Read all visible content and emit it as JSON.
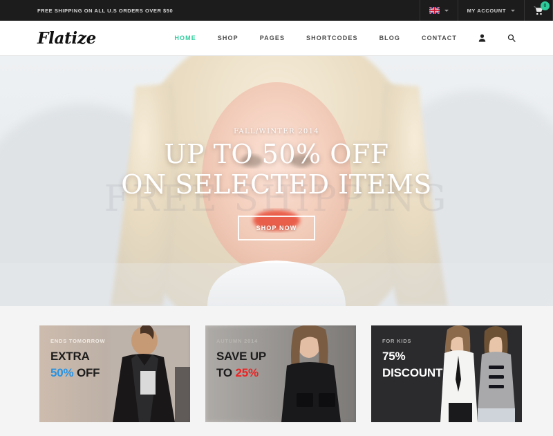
{
  "topbar": {
    "message": "FREE SHIPPING ON ALL U.S ORDERS OVER $50",
    "language": "english-uk-flag",
    "account_label": "MY ACCOUNT",
    "cart_count": "0"
  },
  "header": {
    "logo": "Flatize",
    "nav": [
      {
        "label": "HOME",
        "active": true
      },
      {
        "label": "SHOP",
        "active": false
      },
      {
        "label": "PAGES",
        "active": false
      },
      {
        "label": "SHORTCODES",
        "active": false
      },
      {
        "label": "BLOG",
        "active": false
      },
      {
        "label": "CONTACT",
        "active": false
      }
    ],
    "user_icon": "user-icon",
    "search_icon": "search-icon"
  },
  "hero": {
    "ghost_text": "FREE SHIPPING",
    "kicker": "FALL/WINTER 2014",
    "title_line1": "UP TO 50% OFF",
    "title_line2": "ON SELECTED ITEMS",
    "button": "SHOP NOW"
  },
  "promos": [
    {
      "kicker": "ENDS TOMORROW",
      "line1": "EXTRA",
      "line2_prefix": "50%",
      "line2_suffix": " OFF",
      "accent": "#2a93e0"
    },
    {
      "kicker": "AUTUMN 2014",
      "line1": "SAVE UP",
      "line2_prefix": "TO ",
      "line2_suffix": "25%",
      "accent": "#ee2222"
    },
    {
      "kicker": "FOR KIDS",
      "line1": "75%",
      "line2_prefix": "DISCOUNT",
      "line2_suffix": "",
      "accent": "#2ecc9c"
    }
  ],
  "colors": {
    "accent_teal": "#2ecc9c",
    "topbar_bg": "#1c1c1c",
    "section_bg": "#f4f4f4"
  }
}
